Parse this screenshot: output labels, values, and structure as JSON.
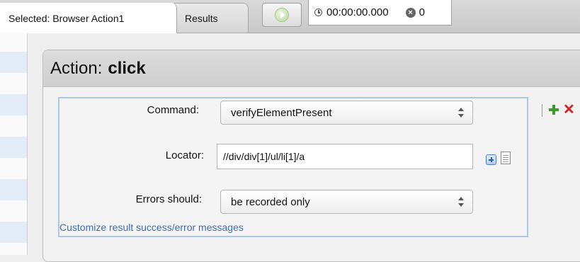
{
  "tabs": {
    "selected_label": "Selected: Browser Action1",
    "results_label": "Results"
  },
  "toolbar": {
    "timer": "00:00:00.000",
    "error_count": "0"
  },
  "action": {
    "prefix": "Action:",
    "name": "click"
  },
  "form": {
    "command_label": "Command:",
    "command_value": "verifyElementPresent",
    "locator_label": "Locator:",
    "locator_value": "//div/div[1]/ul/li[1]/a",
    "errors_label": "Errors should:",
    "errors_value": "be recorded only",
    "customize_link": "Customize result success/error messages"
  },
  "icons": {
    "play": "play-icon",
    "clock": "clock-icon",
    "error": "error-count-icon",
    "add_locator": "add-icon",
    "locator_doc": "document-icon",
    "add_step": "green-plus-icon",
    "delete_step": "red-x-icon"
  }
}
